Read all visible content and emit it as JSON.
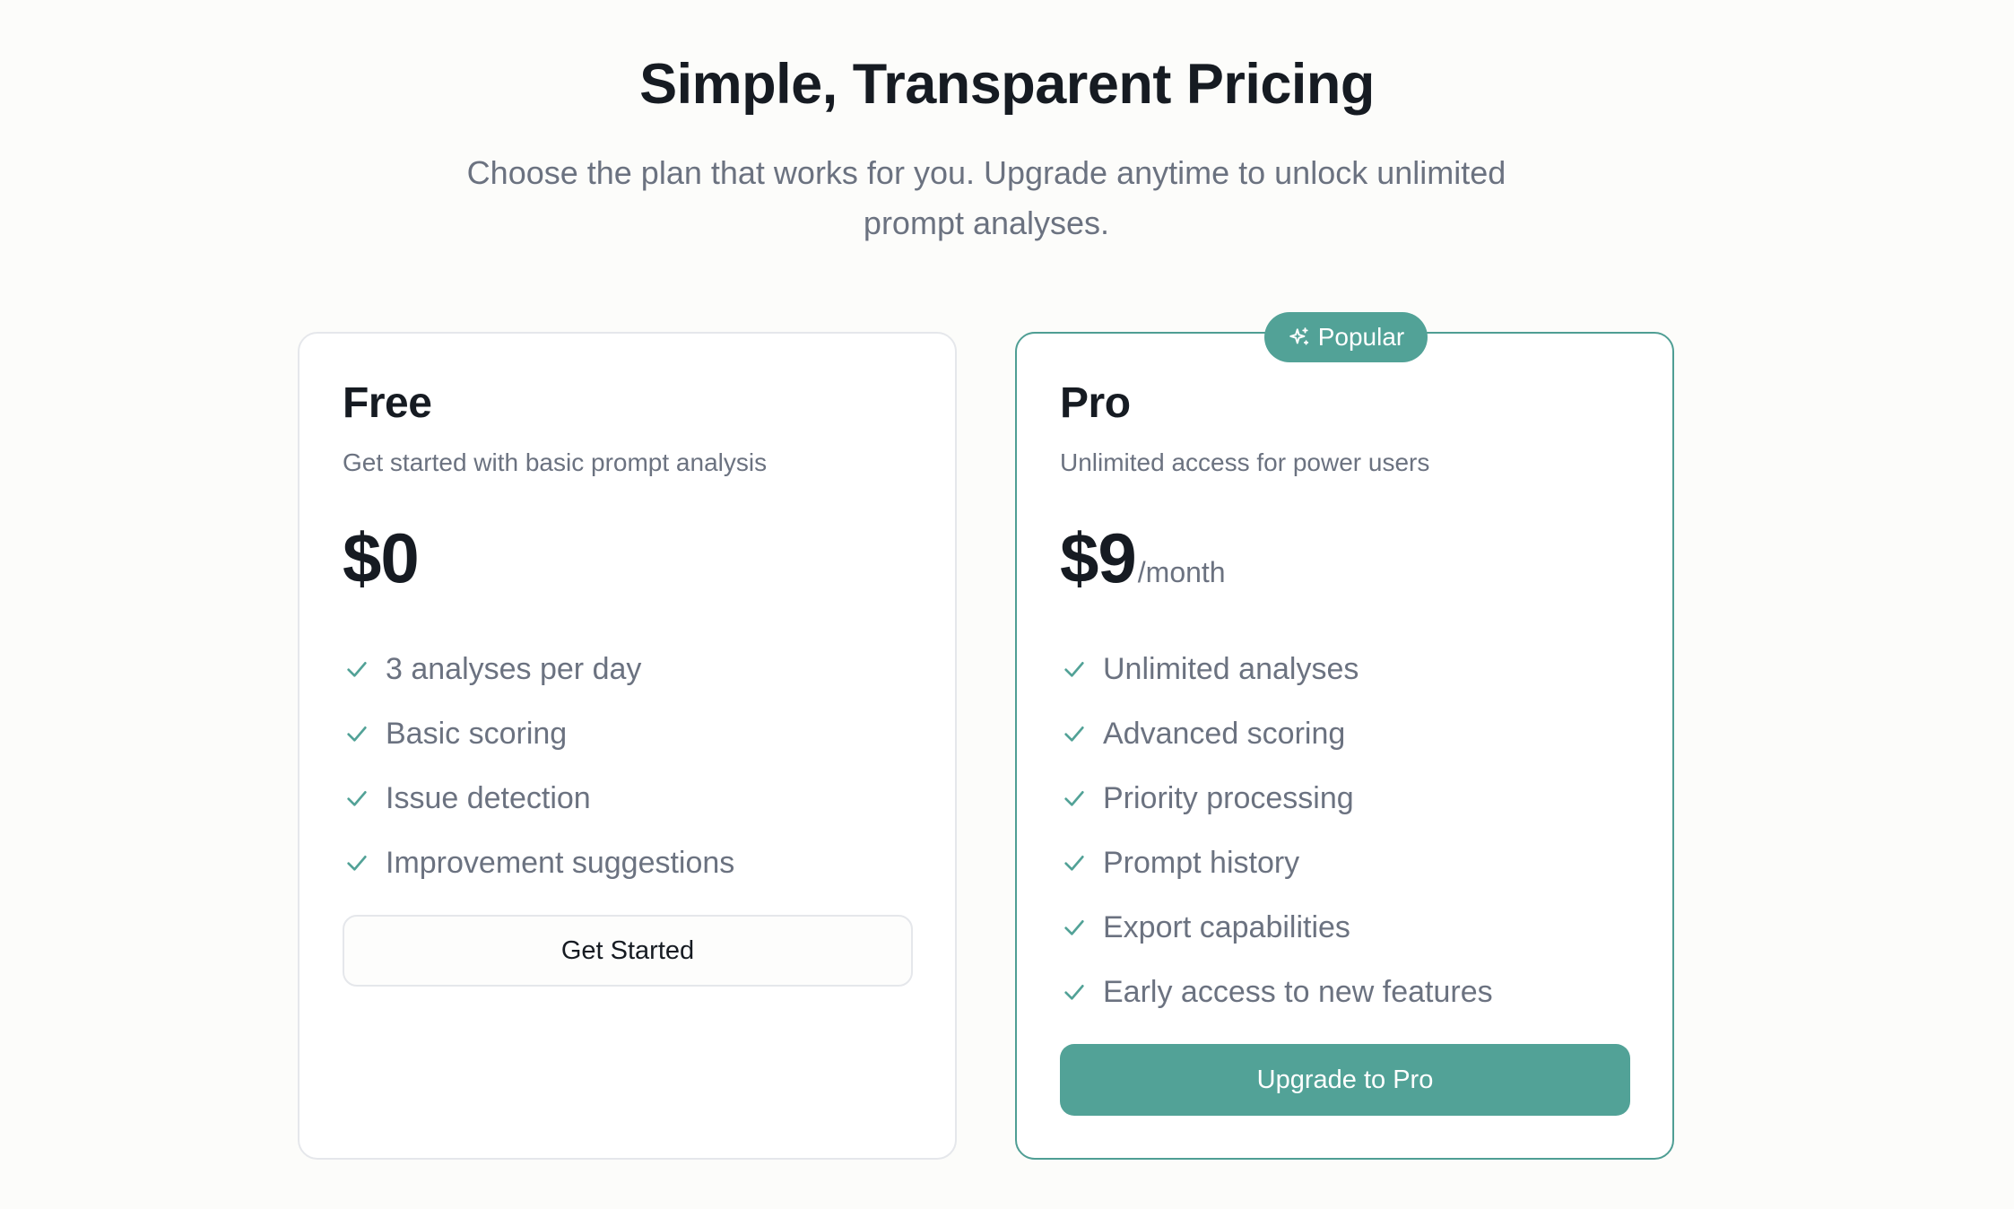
{
  "header": {
    "title": "Simple, Transparent Pricing",
    "subtitle": "Choose the plan that works for you. Upgrade anytime to unlock unlimited prompt analyses."
  },
  "colors": {
    "accent": "#52a297",
    "text_primary": "#161b22",
    "text_muted": "#6b7280",
    "border": "#e5e7eb",
    "background": "#fcfcfa"
  },
  "plans": [
    {
      "name": "Free",
      "description": "Get started with basic prompt analysis",
      "price": "$0",
      "period": "",
      "features": [
        "3 analyses per day",
        "Basic scoring",
        "Issue detection",
        "Improvement suggestions"
      ],
      "cta_label": "Get Started"
    },
    {
      "badge": "Popular",
      "badge_icon": "sparkles-icon",
      "name": "Pro",
      "description": "Unlimited access for power users",
      "price": "$9",
      "period": "/month",
      "features": [
        "Unlimited analyses",
        "Advanced scoring",
        "Priority processing",
        "Prompt history",
        "Export capabilities",
        "Early access to new features"
      ],
      "cta_label": "Upgrade to Pro"
    }
  ]
}
